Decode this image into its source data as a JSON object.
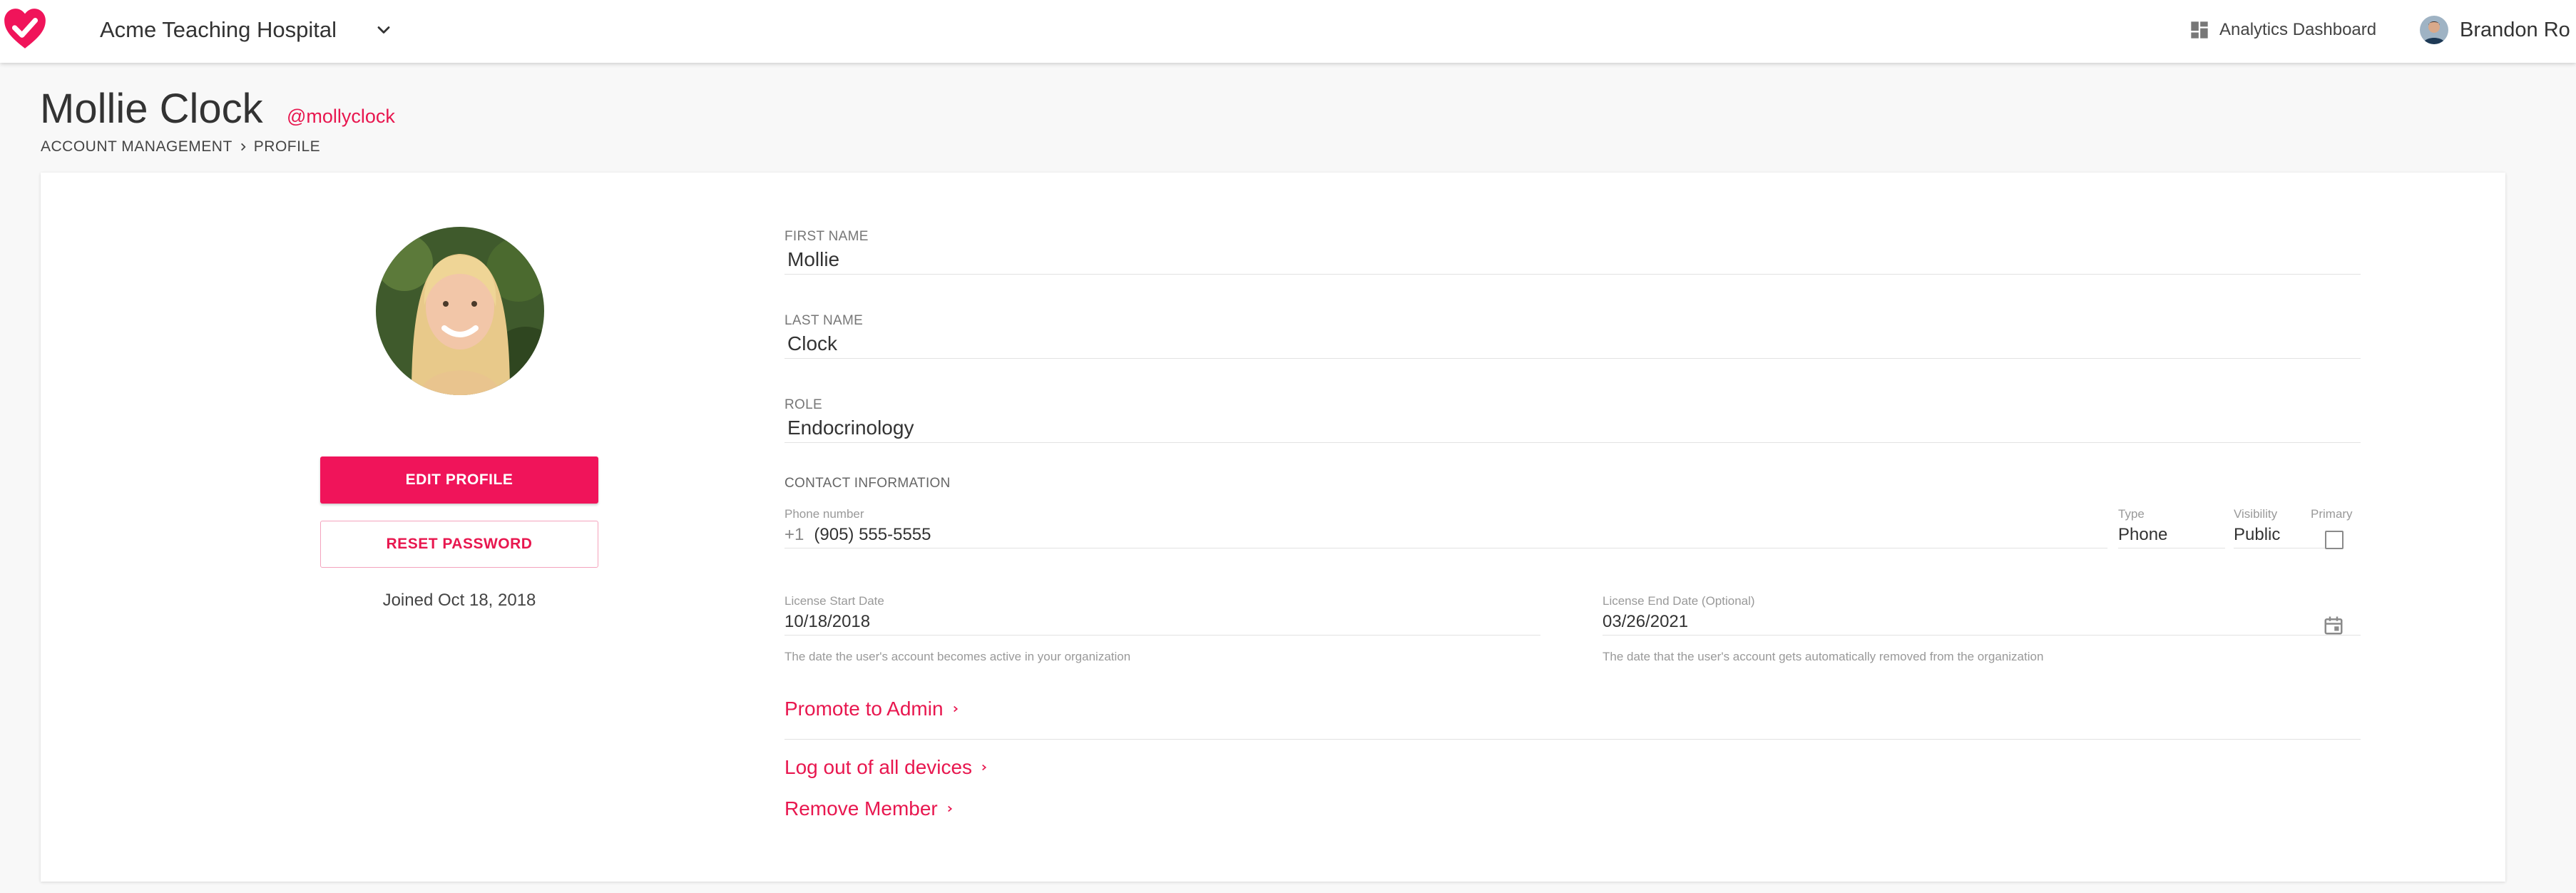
{
  "topbar": {
    "org_name": "Acme Teaching Hospital",
    "analytics_label": "Analytics Dashboard",
    "user_name": "Brandon Ro"
  },
  "header": {
    "title": "Mollie Clock",
    "handle": "@mollyclock",
    "breadcrumb": [
      "ACCOUNT MANAGEMENT",
      "PROFILE"
    ]
  },
  "profile": {
    "edit_label": "EDIT PROFILE",
    "reset_label": "RESET PASSWORD",
    "joined": "Joined Oct 18, 2018"
  },
  "fields": {
    "first_name": {
      "label": "FIRST NAME",
      "value": "Mollie"
    },
    "last_name": {
      "label": "LAST NAME",
      "value": "Clock"
    },
    "role": {
      "label": "ROLE",
      "value": "Endocrinology"
    }
  },
  "contact": {
    "section_label": "CONTACT INFORMATION",
    "phone_label": "Phone number",
    "phone_prefix": "+1",
    "phone_value": "(905) 555-5555",
    "type_label": "Type",
    "type_value": "Phone",
    "visibility_label": "Visibility",
    "visibility_value": "Public",
    "primary_label": "Primary",
    "primary_checked": false
  },
  "license": {
    "start_label": "License Start Date",
    "start_value": "10/18/2018",
    "start_helper": "The date the user's account becomes active in your organization",
    "end_label": "License End Date (Optional)",
    "end_value": "03/26/2021",
    "end_helper": "The date that the user's account gets automatically removed from the organization"
  },
  "actions": {
    "promote": "Promote to Admin",
    "logout_all": "Log out of all devices",
    "remove": "Remove Member"
  },
  "colors": {
    "accent": "#e8174f",
    "button": "#f0145a"
  },
  "icons": {
    "logo": "heart-check-icon",
    "org_dropdown": "chevron-down-icon",
    "analytics": "dashboard-grid-icon",
    "breadcrumb_sep": "chevron-right-icon",
    "calendar": "calendar-icon",
    "link_chevron": "chevron-right-icon"
  }
}
